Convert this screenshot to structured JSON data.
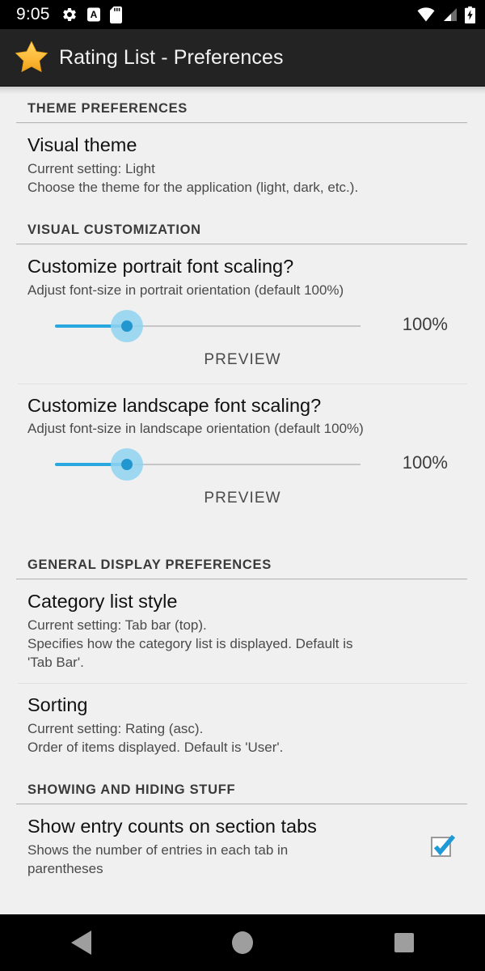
{
  "status_bar": {
    "clock": "9:05",
    "left_icons": [
      "gear-icon",
      "letter-a-icon",
      "sd-card-icon"
    ],
    "right_icons": [
      "wifi-icon",
      "cell-signal-icon",
      "battery-charging-icon"
    ]
  },
  "title_bar": {
    "icon": "star-icon",
    "title": "Rating List - Preferences"
  },
  "sections": [
    {
      "header": "THEME PREFERENCES",
      "prefs": [
        {
          "title": "Visual theme",
          "summary_line1": "Current setting: Light",
          "summary_line2": "Choose the theme for the application (light, dark, etc.)."
        }
      ]
    },
    {
      "header": "VISUAL CUSTOMIZATION",
      "prefs": [
        {
          "title": "Customize portrait font scaling?",
          "summary_line1": "Adjust font-size in portrait orientation (default 100%)",
          "slider_value": "100%",
          "preview_label": "PREVIEW"
        },
        {
          "title": "Customize landscape font scaling?",
          "summary_line1": "Adjust font-size in landscape orientation (default 100%)",
          "slider_value": "100%",
          "preview_label": "PREVIEW"
        }
      ]
    },
    {
      "header": "GENERAL DISPLAY PREFERENCES",
      "prefs": [
        {
          "title": "Category list style",
          "summary_line1": "Current setting: Tab bar (top).",
          "summary_line2": "Specifies how the category list is displayed. Default is",
          "summary_line3": "'Tab Bar'."
        },
        {
          "title": "Sorting",
          "summary_line1": "Current setting: Rating (asc).",
          "summary_line2": "Order of items displayed. Default is 'User'."
        }
      ]
    },
    {
      "header": "SHOWING AND HIDING STUFF",
      "prefs": [
        {
          "title": "Show entry counts on section tabs",
          "summary_line1": "Shows the number of entries in each tab in",
          "summary_line2": "parentheses",
          "checkbox_checked": true
        }
      ]
    }
  ],
  "nav_bar": {
    "back": "back-icon",
    "home": "home-icon",
    "recents": "recents-icon"
  },
  "colors": {
    "accent": "#29a8e0",
    "checkbox_check": "#1f9ad6",
    "star": "#f5b323",
    "title_bar_bg": "#232323",
    "content_bg": "#f0f0f0"
  }
}
